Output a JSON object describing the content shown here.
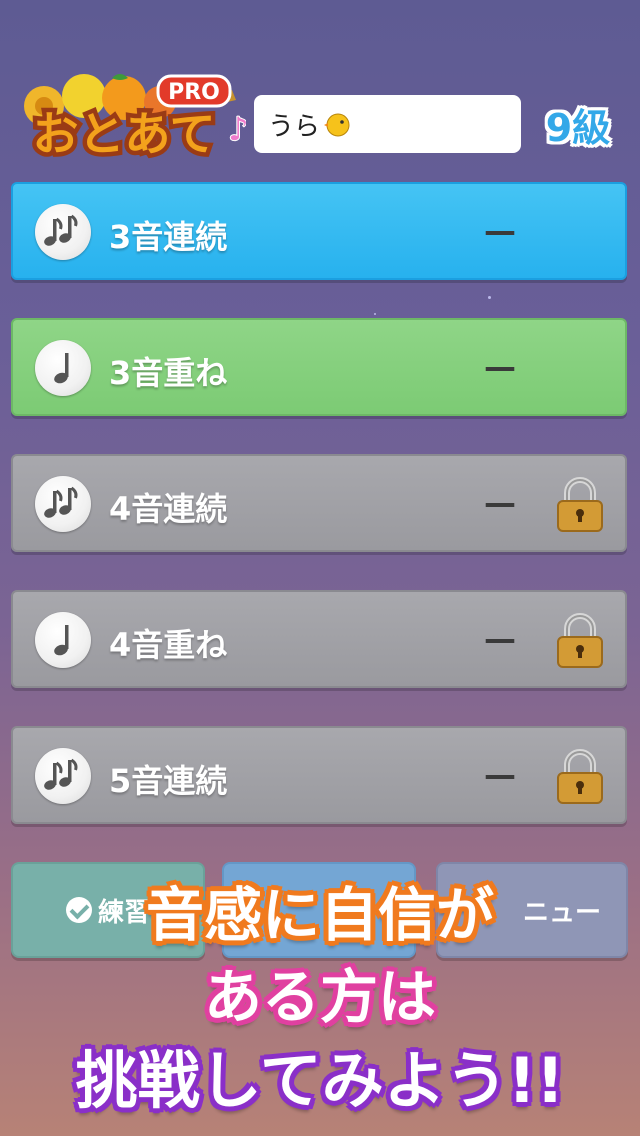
{
  "header": {
    "logo_text": "おとあて",
    "logo_badge": "PRO",
    "user_name": "うら",
    "user_icon": "chick-icon",
    "level": "9級"
  },
  "modes": [
    {
      "label": "3音連続",
      "score": "—",
      "icon": "double-note-icon",
      "color": "#27b1ee",
      "locked": false
    },
    {
      "label": "3音重ね",
      "score": "—",
      "icon": "single-note-icon",
      "color": "#7ccb74",
      "locked": false
    },
    {
      "label": "4音連続",
      "score": "—",
      "icon": "double-note-icon",
      "color": "#9a9a9f",
      "locked": true
    },
    {
      "label": "4音重ね",
      "score": "—",
      "icon": "single-note-icon",
      "color": "#9a9a9f",
      "locked": true
    },
    {
      "label": "5音連続",
      "score": "—",
      "icon": "double-note-icon",
      "color": "#9a9a9f",
      "locked": true
    }
  ],
  "bottom_buttons": {
    "practice_label": "練習",
    "menu_label": "ニュー"
  },
  "promo": {
    "line1": "音感に自信が",
    "line2": "ある方は",
    "line3": "挑戦してみよう!!"
  }
}
